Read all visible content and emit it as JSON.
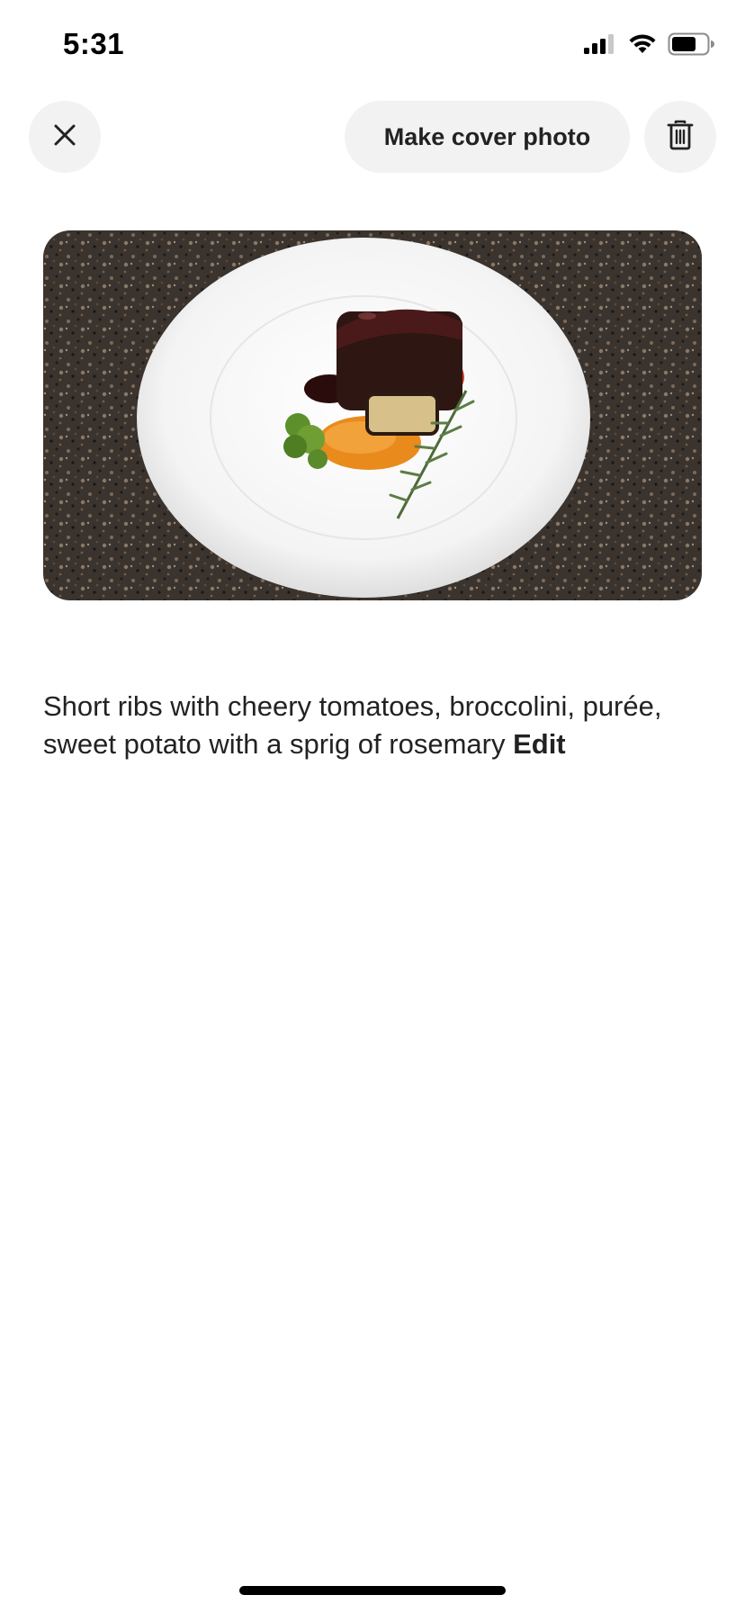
{
  "status_bar": {
    "time": "5:31",
    "icons": [
      "cellular-signal-icon",
      "wifi-icon",
      "battery-icon"
    ]
  },
  "toolbar": {
    "close_icon": "close-icon",
    "cover_label": "Make cover photo",
    "delete_icon": "trash-icon"
  },
  "photo": {
    "subject": "plated-dish"
  },
  "caption": {
    "text": "Short ribs with cheery tomatoes, broccolini, purée, sweet potato with a sprig of rosemary",
    "edit_label": "Edit"
  },
  "colors": {
    "text": "#222222",
    "button_bg": "#f2f2f2",
    "background": "#ffffff"
  }
}
